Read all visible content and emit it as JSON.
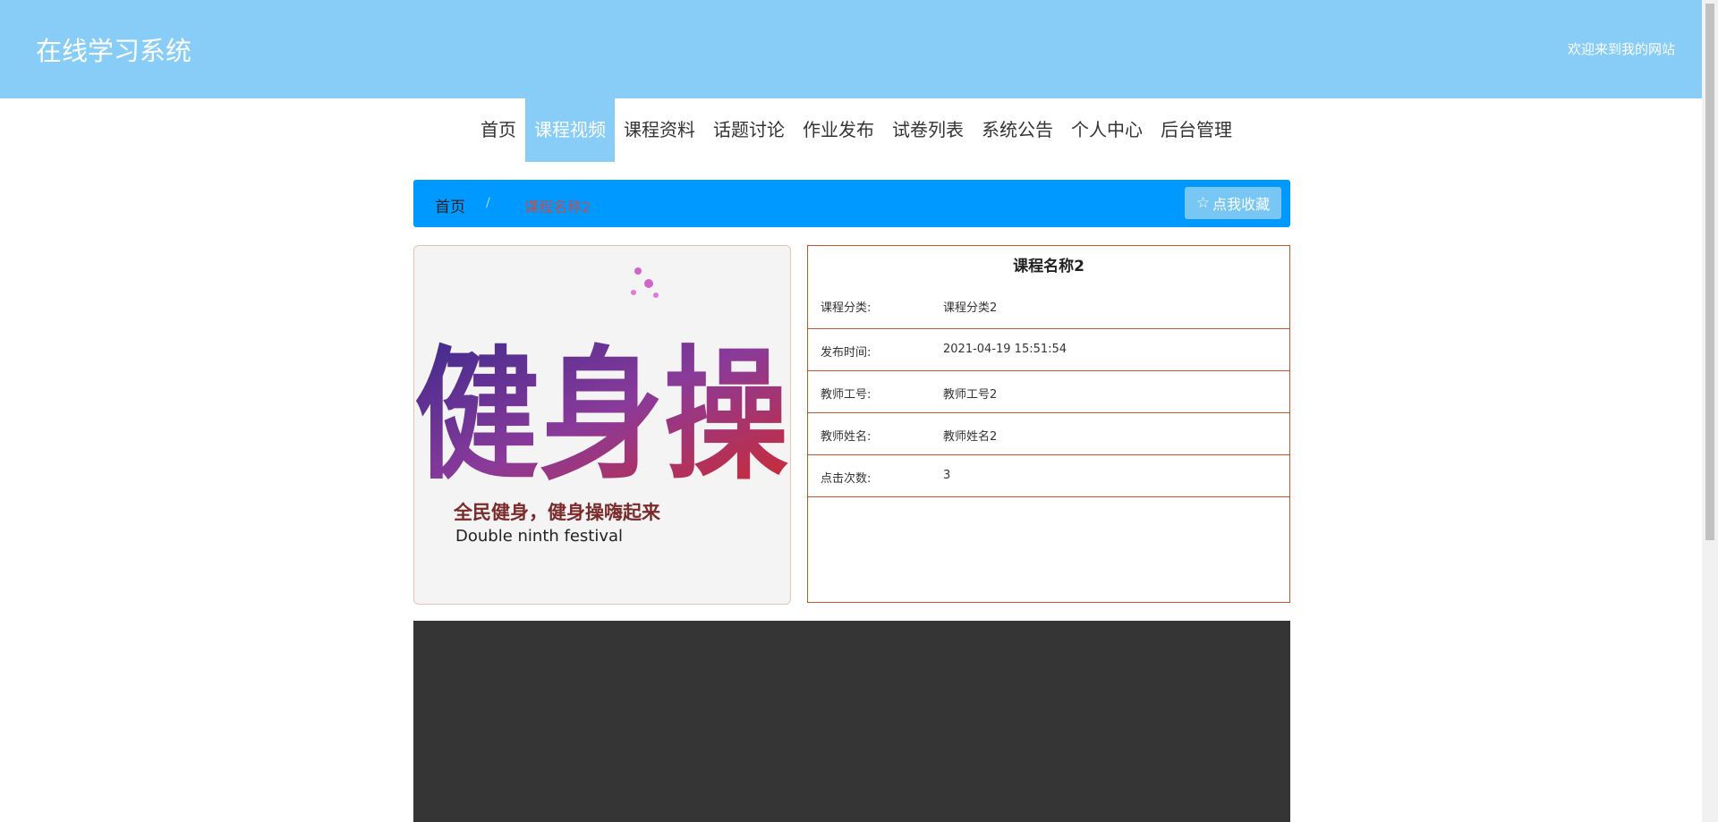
{
  "header": {
    "site_title": "在线学习系统",
    "welcome": "欢迎来到我的网站"
  },
  "nav": {
    "items": [
      {
        "label": "首页"
      },
      {
        "label": "课程视频"
      },
      {
        "label": "课程资料"
      },
      {
        "label": "话题讨论"
      },
      {
        "label": "作业发布"
      },
      {
        "label": "试卷列表"
      },
      {
        "label": "系统公告"
      },
      {
        "label": "个人中心"
      },
      {
        "label": "后台管理"
      }
    ],
    "active_index": 1
  },
  "breadcrumb": {
    "home": "首页",
    "separator": "/",
    "current": "课程名称2",
    "favorite_button": "点我收藏"
  },
  "poster": {
    "title_glyphs": "健身操",
    "slogan": "全民健身，健身操嗨起来",
    "subtitle": "Double ninth festival"
  },
  "course": {
    "title": "课程名称2",
    "rows": [
      {
        "label": "课程分类:",
        "value": "课程分类2"
      },
      {
        "label": "发布时间:",
        "value": "2021-04-19 15:51:54"
      },
      {
        "label": "教师工号:",
        "value": "教师工号2"
      },
      {
        "label": "教师姓名:",
        "value": "教师姓名2"
      },
      {
        "label": "点击次数:",
        "value": "3"
      }
    ]
  },
  "colors": {
    "header_bg": "#87cdf7",
    "breadcrumb_bg": "#0099ff",
    "detail_border": "#c0562d",
    "video_bg": "#353535"
  }
}
